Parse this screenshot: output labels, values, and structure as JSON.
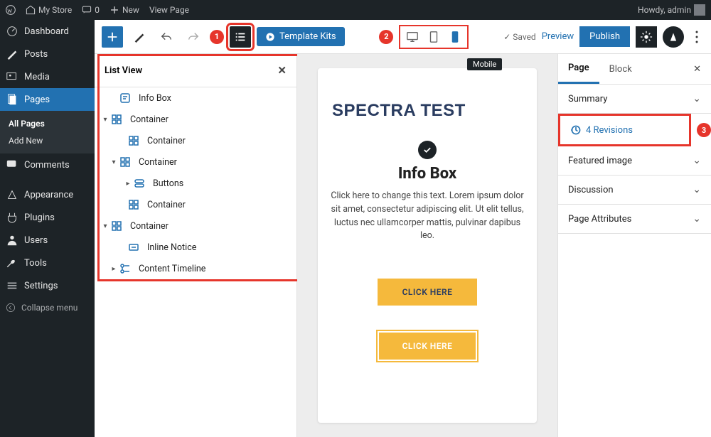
{
  "adminbar": {
    "site": "My Store",
    "comments": "0",
    "new": "New",
    "viewpage": "View Page",
    "greeting": "Howdy, admin"
  },
  "sidebar": {
    "items": [
      {
        "label": "Dashboard"
      },
      {
        "label": "Posts"
      },
      {
        "label": "Media"
      },
      {
        "label": "Pages"
      },
      {
        "label": "Comments"
      },
      {
        "label": "Appearance"
      },
      {
        "label": "Plugins"
      },
      {
        "label": "Users"
      },
      {
        "label": "Tools"
      },
      {
        "label": "Settings"
      }
    ],
    "subpages": {
      "all": "All Pages",
      "add": "Add New"
    },
    "collapse": "Collapse menu"
  },
  "toolbar": {
    "template_kits": "Template Kits",
    "saved": "Saved",
    "preview": "Preview",
    "publish": "Publish",
    "tooltip": "Mobile",
    "badge1": "1",
    "badge2": "2",
    "badge3": "3"
  },
  "listview": {
    "title": "List View",
    "items": [
      {
        "label": "Info Box"
      },
      {
        "label": "Container"
      },
      {
        "label": "Container"
      },
      {
        "label": "Container"
      },
      {
        "label": "Buttons"
      },
      {
        "label": "Container"
      },
      {
        "label": "Container"
      },
      {
        "label": "Inline Notice"
      },
      {
        "label": "Content Timeline"
      }
    ]
  },
  "canvas": {
    "h1": "SPECTRA TEST",
    "h2": "Info Box",
    "p": "Click here to change this text. Lorem ipsum dolor sit amet, consectetur adipiscing elit. Ut elit tellus, luctus nec ullamcorper mattis, pulvinar dapibus leo.",
    "cta1": "CLICK HERE",
    "cta2": "CLICK HERE"
  },
  "rightpanel": {
    "tab_page": "Page",
    "tab_block": "Block",
    "summary": "Summary",
    "revisions": "4 Revisions",
    "featured": "Featured image",
    "discussion": "Discussion",
    "attributes": "Page Attributes"
  }
}
